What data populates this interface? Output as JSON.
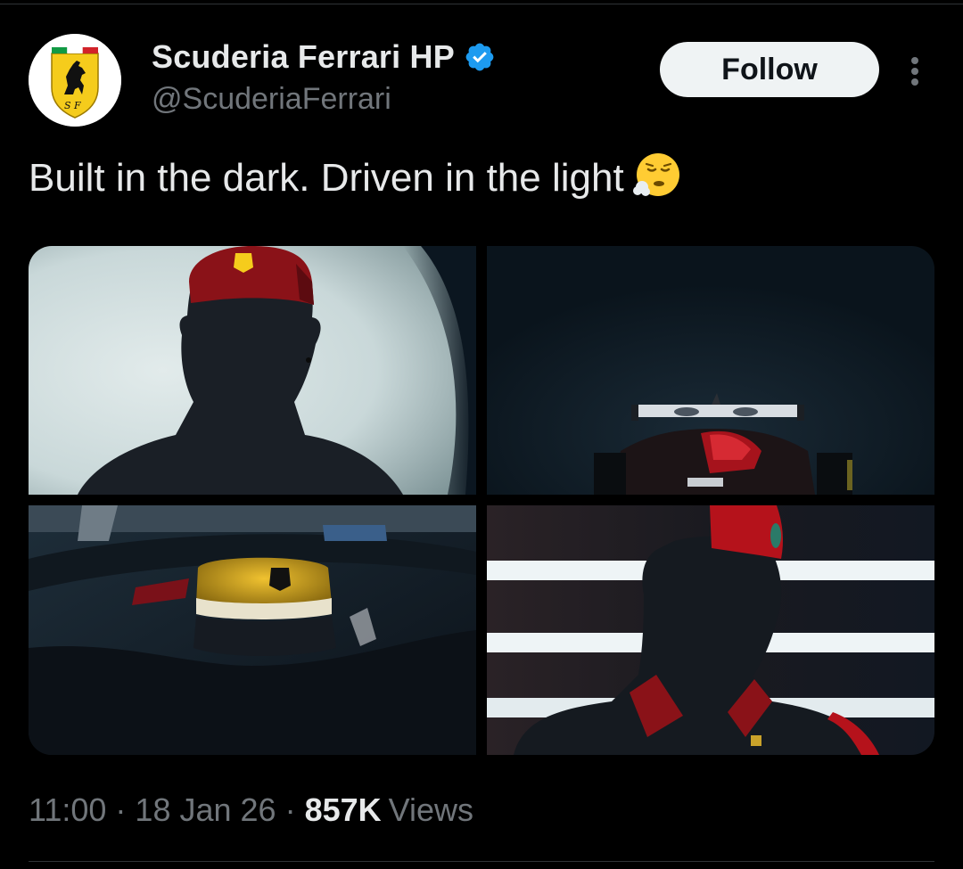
{
  "author": {
    "display_name": "Scuderia Ferrari HP",
    "handle": "@ScuderiaFerrari",
    "avatar_icon": "ferrari-shield-logo",
    "verified_icon": "verified-badge-icon",
    "verified_color": "#1d9bf0"
  },
  "actions": {
    "follow_label": "Follow",
    "more_icon": "more-vertical-icon"
  },
  "tweet": {
    "text": "Built in the dark. Driven in the light",
    "emoji": "exhaling-face-emoji"
  },
  "media": [
    {
      "icon": "photo-driver-silhouette-cap"
    },
    {
      "icon": "photo-car-rear-wing-dark"
    },
    {
      "icon": "photo-helmet-cockpit"
    },
    {
      "icon": "photo-driver-light-stripes"
    }
  ],
  "meta": {
    "time": "11:00",
    "separator": "·",
    "date": "18 Jan 26",
    "views_count": "857K",
    "views_label": "Views"
  },
  "colors": {
    "background": "#000000",
    "primary_text": "#e7e9ea",
    "secondary_text": "#71767b",
    "ferrari_yellow": "#f5cc1c",
    "ferrari_red": "#b5121b"
  }
}
